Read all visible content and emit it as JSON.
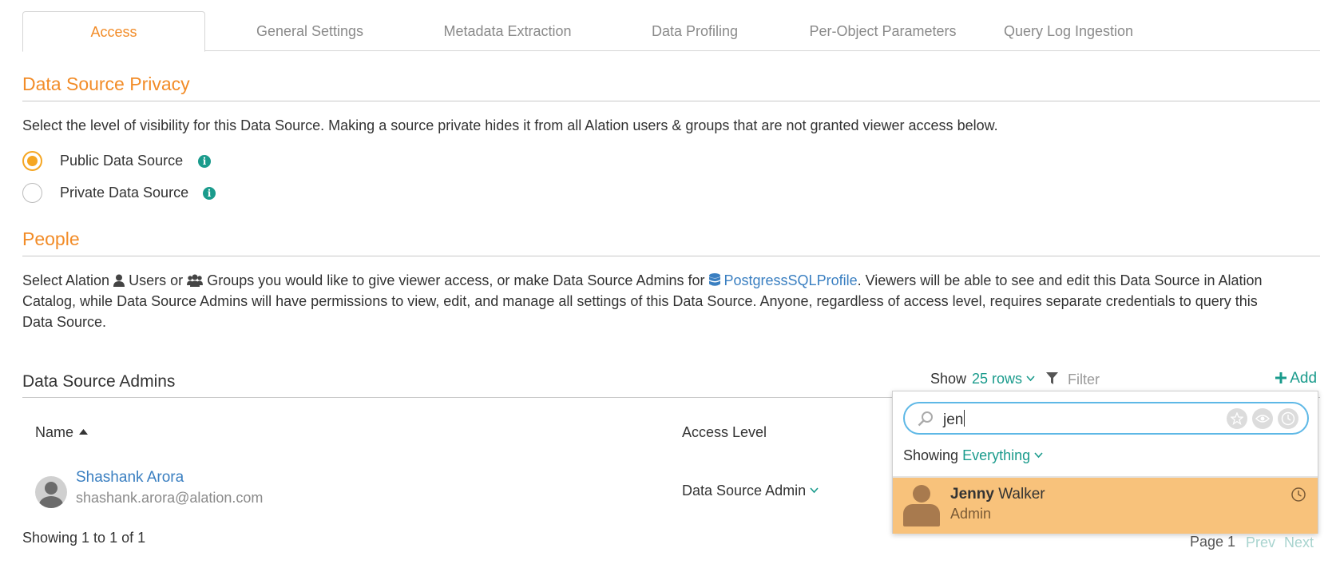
{
  "tabs": [
    {
      "label": "Access",
      "active": true
    },
    {
      "label": "General Settings"
    },
    {
      "label": "Metadata Extraction"
    },
    {
      "label": "Data Profiling"
    },
    {
      "label": "Per-Object Parameters"
    },
    {
      "label": "Query Log Ingestion"
    }
  ],
  "privacy": {
    "title": "Data Source Privacy",
    "description": "Select the level of visibility for this Data Source. Making a source private hides it from all Alation users & groups that are not granted viewer access below.",
    "options": [
      {
        "label": "Public Data Source",
        "selected": true
      },
      {
        "label": "Private Data Source",
        "selected": false
      }
    ]
  },
  "people": {
    "title": "People",
    "desc_prefix": "Select Alation",
    "users_label": "Users",
    "or_text": "or",
    "groups_label": "Groups",
    "desc_middle": "you would like to give viewer access, or make Data Source Admins for",
    "datasource_link": "PostgressSQLProfile",
    "desc_line1_end": ". Viewers will be able to see and edit this Data Source in Alation",
    "desc_line2": "Catalog, while Data Source Admins will have permissions to view, edit, and manage all settings of this Data Source. Anyone, regardless of access level, requires separate credentials to query this",
    "desc_line3": "Data Source."
  },
  "admins": {
    "title": "Data Source Admins",
    "show_label": "Show",
    "rows_label": "25 rows",
    "filter_placeholder": "Filter",
    "add_label": "Add",
    "columns": {
      "name": "Name",
      "access": "Access Level"
    },
    "rows": [
      {
        "name": "Shashank Arora",
        "email": "shashank.arora@alation.com",
        "access": "Data Source Admin"
      }
    ],
    "footer": "Showing 1 to 1 of 1",
    "page_label": "Page 1",
    "prev": "Prev",
    "next": "Next"
  },
  "search_popup": {
    "query": "jen",
    "showing_label": "Showing",
    "scope": "Everything",
    "result": {
      "first": "Jenny",
      "last": "Walker",
      "role": "Admin"
    }
  },
  "colors": {
    "accent": "#f28c28",
    "teal": "#1a9b8c",
    "link": "#3a7fc1",
    "highlight": "#f8c27b"
  }
}
